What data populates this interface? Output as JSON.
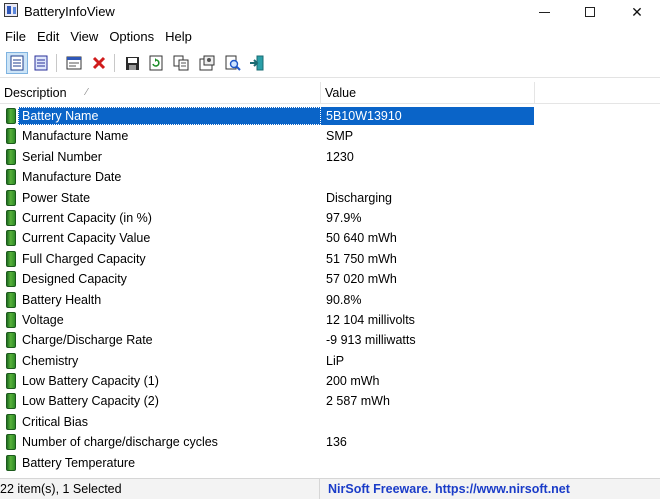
{
  "window": {
    "title": "BatteryInfoView"
  },
  "menu": [
    "File",
    "Edit",
    "View",
    "Options",
    "Help"
  ],
  "toolbar": {
    "buttons": [
      {
        "icon": "html-report-all-icon",
        "active": true
      },
      {
        "icon": "html-report-selected-icon",
        "active": false
      },
      {
        "icon": "properties-icon",
        "active": false
      },
      {
        "icon": "delete-icon",
        "active": false
      },
      {
        "icon": "save-icon",
        "active": false
      },
      {
        "icon": "refresh-icon",
        "active": false
      },
      {
        "icon": "copy-icon",
        "active": false
      },
      {
        "icon": "options-icon",
        "active": false
      },
      {
        "icon": "find-icon",
        "active": false
      },
      {
        "icon": "exit-icon",
        "active": false
      }
    ]
  },
  "columns": {
    "description": "Description",
    "value": "Value"
  },
  "rows": [
    {
      "description": "Battery Name",
      "value": "5B10W13910",
      "selected": true
    },
    {
      "description": "Manufacture Name",
      "value": "SMP"
    },
    {
      "description": "Serial Number",
      "value": " 1230"
    },
    {
      "description": "Manufacture Date",
      "value": ""
    },
    {
      "description": "Power State",
      "value": "Discharging"
    },
    {
      "description": "Current Capacity (in %)",
      "value": "97.9%"
    },
    {
      "description": "Current Capacity Value",
      "value": "50 640 mWh"
    },
    {
      "description": "Full Charged Capacity",
      "value": "51 750 mWh"
    },
    {
      "description": "Designed Capacity",
      "value": "57 020 mWh"
    },
    {
      "description": "Battery Health",
      "value": "90.8%"
    },
    {
      "description": "Voltage",
      "value": "12 104 millivolts"
    },
    {
      "description": "Charge/Discharge Rate",
      "value": "-9 913 milliwatts"
    },
    {
      "description": "Chemistry",
      "value": "LiP"
    },
    {
      "description": "Low Battery Capacity (1)",
      "value": "200 mWh"
    },
    {
      "description": "Low Battery Capacity (2)",
      "value": "2 587 mWh"
    },
    {
      "description": "Critical Bias",
      "value": ""
    },
    {
      "description": "Number of charge/discharge cycles",
      "value": "136"
    },
    {
      "description": "Battery Temperature",
      "value": ""
    }
  ],
  "status": {
    "items": "22 item(s), 1 Selected",
    "link": "NirSoft Freeware. https://www.nirsoft.net"
  },
  "colors": {
    "selection": "#0a64c8",
    "link": "#1a3cc8",
    "battery": "#2d8a27"
  }
}
